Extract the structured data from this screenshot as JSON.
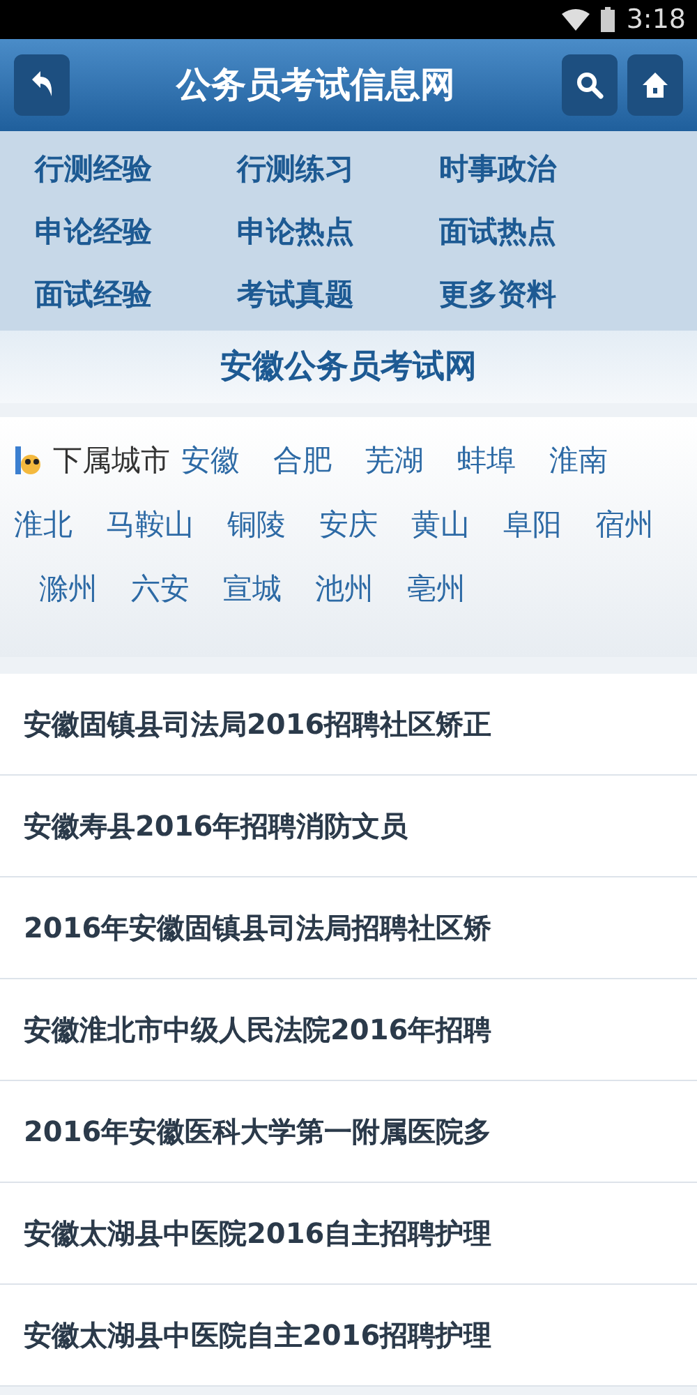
{
  "status_bar": {
    "time": "3:18"
  },
  "header": {
    "title": "公务员考试信息网"
  },
  "nav_links": [
    "行测经验",
    "行测练习",
    "时事政治",
    "申论经验",
    "申论热点",
    "面试热点",
    "面试经验",
    "考试真题",
    "更多资料"
  ],
  "section_title": "安徽公务员考试网",
  "cities": {
    "label": "下属城市",
    "items": [
      "安徽",
      "合肥",
      "芜湖",
      "蚌埠",
      "淮南",
      "淮北",
      "马鞍山",
      "铜陵",
      "安庆",
      "黄山",
      "阜阳",
      "宿州",
      "滁州",
      "六安",
      "宣城",
      "池州",
      "亳州"
    ]
  },
  "articles": [
    "安徽固镇县司法局2016招聘社区矫正",
    "安徽寿县2016年招聘消防文员",
    "2016年安徽固镇县司法局招聘社区矫",
    "安徽淮北市中级人民法院2016年招聘",
    "2016年安徽医科大学第一附属医院多",
    "安徽太湖县中医院2016自主招聘护理",
    "安徽太湖县中医院自主2016招聘护理"
  ]
}
